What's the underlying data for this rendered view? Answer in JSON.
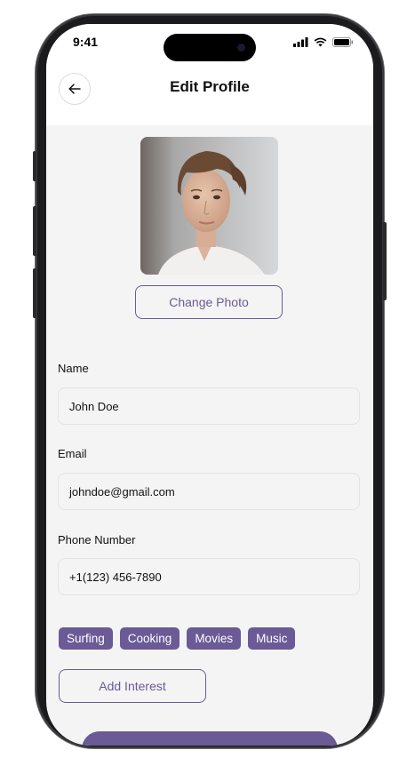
{
  "status_bar": {
    "time": "9:41",
    "icons": [
      "cellular-signal-icon",
      "wifi-icon",
      "battery-icon"
    ]
  },
  "header": {
    "title": "Edit Profile",
    "back_icon": "arrow-left-icon"
  },
  "profile": {
    "change_photo_label": "Change Photo"
  },
  "form": {
    "name_label": "Name",
    "name_value": "John Doe",
    "email_label": "Email",
    "email_value": "johndoe@gmail.com",
    "phone_label": "Phone Number",
    "phone_value": "+1(123) 456-7890"
  },
  "interests": {
    "items": [
      "Surfing",
      "Cooking",
      "Movies",
      "Music"
    ],
    "add_label": "Add Interest"
  },
  "colors": {
    "accent": "#6a5a96",
    "background": "#f4f4f4",
    "header_bg": "#ffffff"
  }
}
